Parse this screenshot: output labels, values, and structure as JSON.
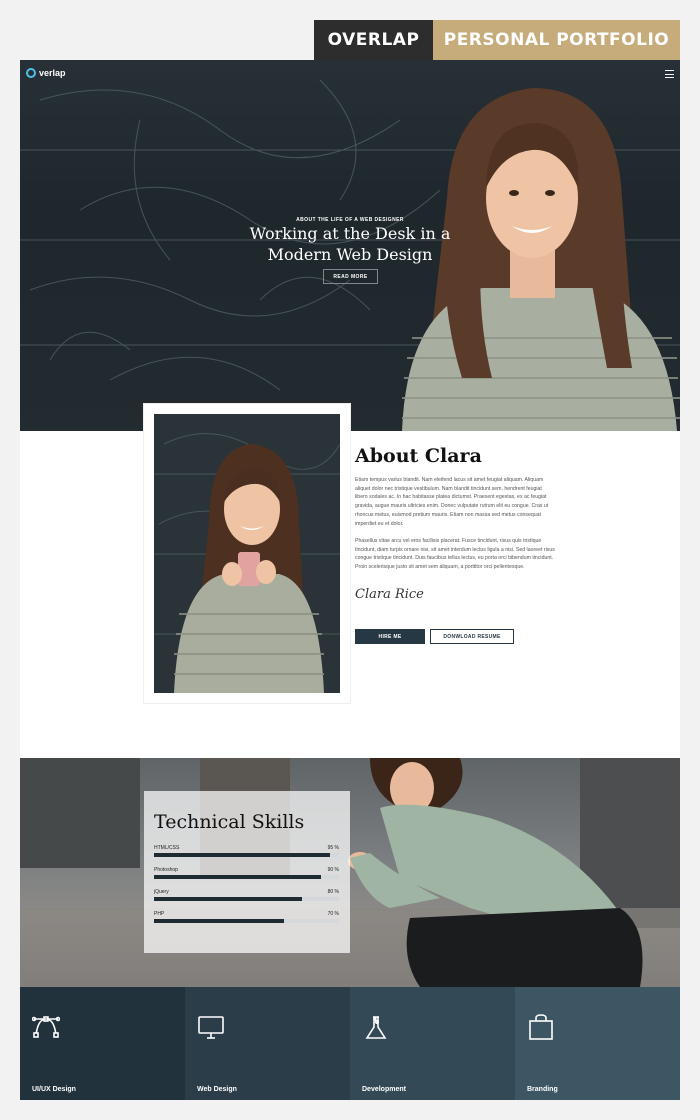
{
  "tags": {
    "left": "OVERLAP",
    "right": "PERSONAL PORTFOLIO"
  },
  "nav": {
    "logo_text": "verlap"
  },
  "hero": {
    "kicker": "ABOUT THE LIFE OF A WEB DESIGNER",
    "title": "Working at the Desk in a Modern Web Design",
    "button": "READ MORE"
  },
  "about": {
    "title": "About Clara",
    "paragraph1": "Etiam tempus varius blandit. Nam eleifend lacus sit amet feugiat aliquam. Aliquam aliquet dolor nec tristique vestibulum. Nam blandit tincidunt sem, hendrerit feugiat libero sodales ac. In hac habitasse platea dictumst. Praesent egestas, ex ac feugiat gravida, augue mauris ultricies enim. Donec vulputate rutrum elit eu congue. Cras ut rhoncus metus, euismod pretium mauris. Etiam non massa sed metus consequat imperdiet eu et dolor.",
    "paragraph2": "Phasellus vitae arcu vel eros facilisis placerat. Fusce tincidunt, risus quis tristique tincidunt, diam turpis ornare nisi, sit amet interdum lectus ligula a nisi. Sed laoreet risus congue tristique tincidunt. Duis faucibus tellus lectus, eu porta orci bibendum tincidunt. Proin scelerisque justo sit amet sem aliquam, a porttitor orci pellentesque.",
    "signature": "Clara Rice",
    "hire_button": "HIRE ME",
    "resume_button": "DONWLOAD RESUME"
  },
  "skills": {
    "title": "Technical Skills",
    "items": [
      {
        "name": "HTML/CSS",
        "percent_label": "95 %",
        "value": 95
      },
      {
        "name": "Photoshop",
        "percent_label": "90 %",
        "value": 90
      },
      {
        "name": "jQuery",
        "percent_label": "80 %",
        "value": 80
      },
      {
        "name": "PHP",
        "percent_label": "70 %",
        "value": 70
      }
    ]
  },
  "services": [
    {
      "label": "UI/UX Design",
      "icon": "bezier-curve-icon",
      "color": "#22323c"
    },
    {
      "label": "Web Design",
      "icon": "monitor-icon",
      "color": "#2a3d48"
    },
    {
      "label": "Development",
      "icon": "flask-icon",
      "color": "#334a56"
    },
    {
      "label": "Branding",
      "icon": "shopping-bag-icon",
      "color": "#3c5663"
    }
  ],
  "colors": {
    "tag_dark": "#2d2d2d",
    "tag_gold": "#c6ab7b",
    "accent_dark": "#263843",
    "logo_ring": "#4fc1e9"
  }
}
